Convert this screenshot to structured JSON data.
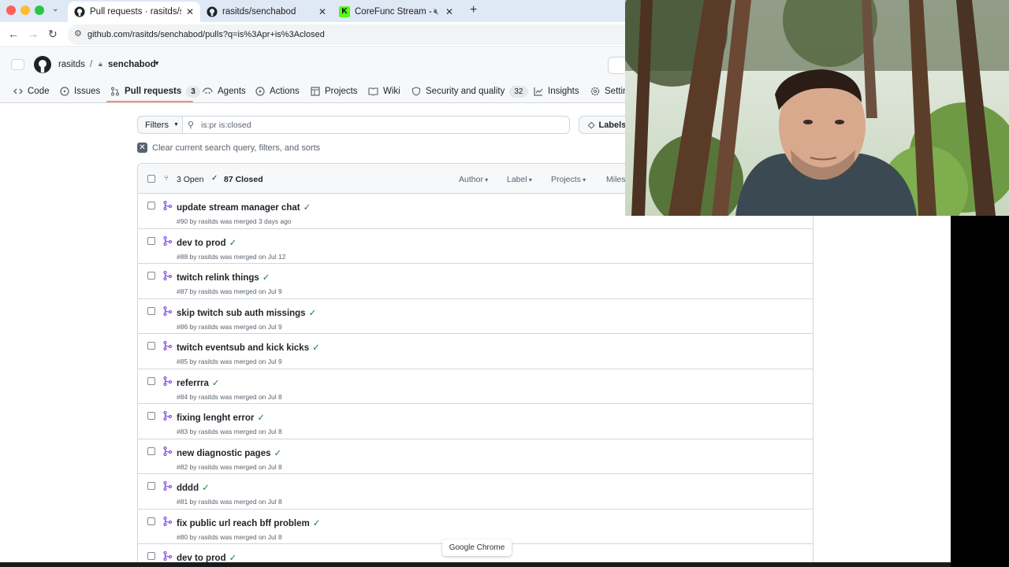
{
  "tabs": [
    {
      "title": "Pull requests · rasitds/sencha"
    },
    {
      "title": "rasitds/senchabod"
    },
    {
      "title": "CoreFunc Stream - Watch"
    }
  ],
  "url": "github.com/rasitds/senchabod/pulls?q=is%3Apr+is%3Aclosed",
  "repo": {
    "owner": "rasitds",
    "name": "senchabod"
  },
  "nav": {
    "code": "Code",
    "issues": "Issues",
    "pulls": "Pull requests",
    "pulls_count": "3",
    "agents": "Agents",
    "actions": "Actions",
    "projects": "Projects",
    "wiki": "Wiki",
    "security": "Security and quality",
    "security_count": "32",
    "insights": "Insights",
    "settings": "Settin"
  },
  "toolbar": {
    "filters": "Filters",
    "query": "is:pr is:closed",
    "labels": "Labels",
    "clear": "Clear current search query, filters, and sorts"
  },
  "list_header": {
    "open": "3 Open",
    "closed": "87 Closed",
    "author": "Author",
    "label": "Label",
    "projects": "Projects",
    "milestones": "Miles"
  },
  "prs": [
    {
      "title": "update stream manager chat",
      "meta": "#90 by rasitds was merged 3 days ago"
    },
    {
      "title": "dev to prod",
      "meta": "#88 by rasitds was merged on Jul 12"
    },
    {
      "title": "twitch relink things",
      "meta": "#87 by rasitds was merged on Jul 9"
    },
    {
      "title": "skip twitch sub auth missings",
      "meta": "#86 by rasitds was merged on Jul 9"
    },
    {
      "title": "twitch eventsub and kick kicks",
      "meta": "#85 by rasitds was merged on Jul 9"
    },
    {
      "title": "referrra",
      "meta": "#84 by rasitds was merged on Jul 8"
    },
    {
      "title": "fixing lenght error",
      "meta": "#83 by rasitds was merged on Jul 8"
    },
    {
      "title": "new diagnostic pages",
      "meta": "#82 by rasitds was merged on Jul 8"
    },
    {
      "title": "dddd",
      "meta": "#81 by rasitds was merged on Jul 8"
    },
    {
      "title": "fix public url reach bff problem",
      "meta": "#80 by rasitds was merged on Jul 8"
    },
    {
      "title": "dev to prod",
      "meta": ""
    }
  ],
  "tooltip": "Google Chrome",
  "colors": {
    "merged": "#8250df",
    "check": "#1a7f37",
    "accent": "#fd8c73"
  }
}
